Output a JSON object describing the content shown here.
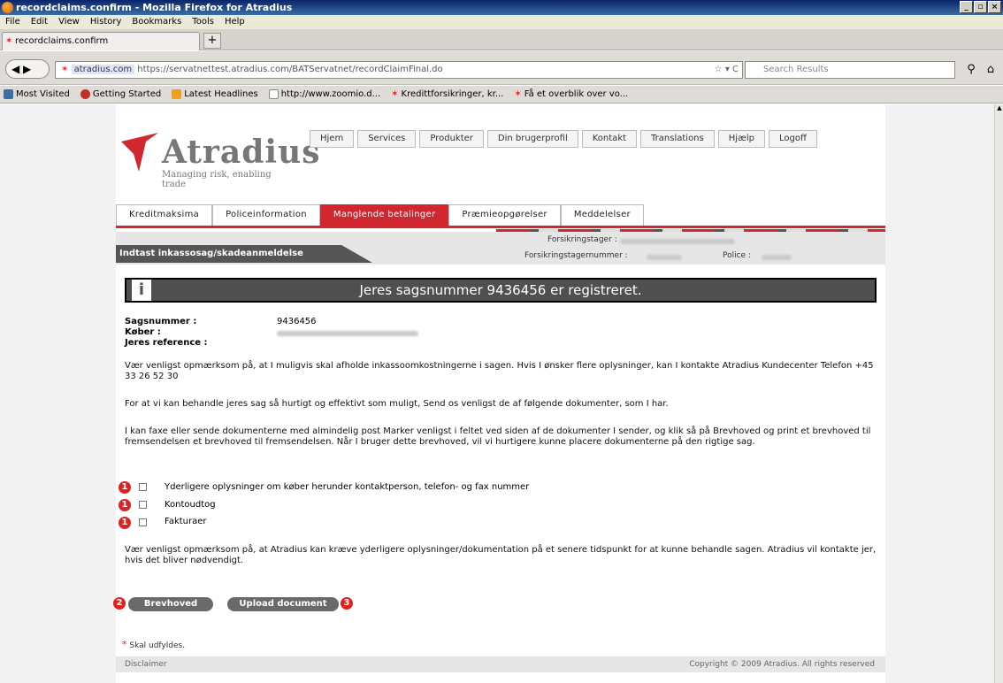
{
  "window": {
    "title": "recordclaims.confirm - Mozilla Firefox for Atradius"
  },
  "menu": [
    "File",
    "Edit",
    "View",
    "History",
    "Bookmarks",
    "Tools",
    "Help"
  ],
  "browser_tab": {
    "label": "recordclaims.confirm"
  },
  "url": {
    "domain": "atradius.com",
    "full": "https://servatnettest.atradius.com/BATServatnet/recordClaimFinal.do"
  },
  "search": {
    "placeholder": "Search Results"
  },
  "bookmarks": [
    "Most Visited",
    "Getting Started",
    "Latest Headlines",
    "http://www.zoomio.d...",
    "Kredittforsikringer, kr...",
    "Få et overblik over vo..."
  ],
  "brand": {
    "name": "Atradius",
    "tagline": "Managing risk, enabling trade",
    "color": "#d0282e"
  },
  "topnav": [
    "Hjem",
    "Services",
    "Produkter",
    "Din brugerprofil",
    "Kontakt",
    "Translations",
    "Hjælp",
    "Logoff"
  ],
  "subtabs": [
    {
      "label": "Kreditmaksima",
      "active": false
    },
    {
      "label": "Policeinformation",
      "active": false
    },
    {
      "label": "Manglende betalinger",
      "active": true
    },
    {
      "label": "Præmieopgørelser",
      "active": false
    },
    {
      "label": "Meddelelser",
      "active": false
    }
  ],
  "page_title": "Indtast inkassosag/skadeanmeldelse",
  "info": {
    "forsikringstager": "Forsikringstager :",
    "forsikringstagernummer": "Forsikringstagernummer :",
    "police": "Police :"
  },
  "confirmation": {
    "icon": "i",
    "text": "Jeres sagsnummer 9436456 er registreret."
  },
  "fields": {
    "sagsnummer_label": "Sagsnummer :",
    "sagsnummer_value": "9436456",
    "koeber_label": "Køber :",
    "reference_label": "Jeres reference :"
  },
  "paragraphs": [
    "Vær venligst opmærksom på, at I muligvis skal afholde inkassoomkostningerne i sagen.  Hvis I ønsker flere oplysninger, kan I kontakte Atradius Kundecenter Telefon +45 33 26 52 30",
    "For at vi kan behandle jeres sag så hurtigt og effektivt som muligt,  Send os venligst de af følgende dokumenter, som I har.",
    "I kan faxe eller sende dokumenterne med almindelig post Marker venligst i feltet ved siden af de dokumenter I sender, og klik så på Brevhoved og print et brevhoved til fremsendelsen et brevhoved til fremsendelsen.  Når I bruger dette brevhoved, vil vi hurtigere kunne placere dokumenterne på den rigtige sag.",
    "Vær venligst opmærksom på, at Atradius kan kræve yderligere oplysninger/dokumentation på et senere tidspunkt for at kunne behandle sagen. Atradius vil kontakte jer, hvis det bliver nødvendigt."
  ],
  "checkboxes": [
    {
      "badge": "1",
      "label": "Yderligere oplysninger om køber herunder kontaktperson, telefon- og fax nummer"
    },
    {
      "badge": "1",
      "label": "Kontoudtog"
    },
    {
      "badge": "1",
      "label": "Fakturaer"
    }
  ],
  "buttons": {
    "brevhoved": "Brevhoved",
    "brevhoved_badge": "2",
    "upload": "Upload document",
    "upload_badge": "3"
  },
  "required_note": {
    "star": "*",
    "text": "Skal udfyldes."
  },
  "footer": {
    "left": "Disclaimer",
    "right": "Copyright © 2009 Atradius. All rights reserved"
  }
}
